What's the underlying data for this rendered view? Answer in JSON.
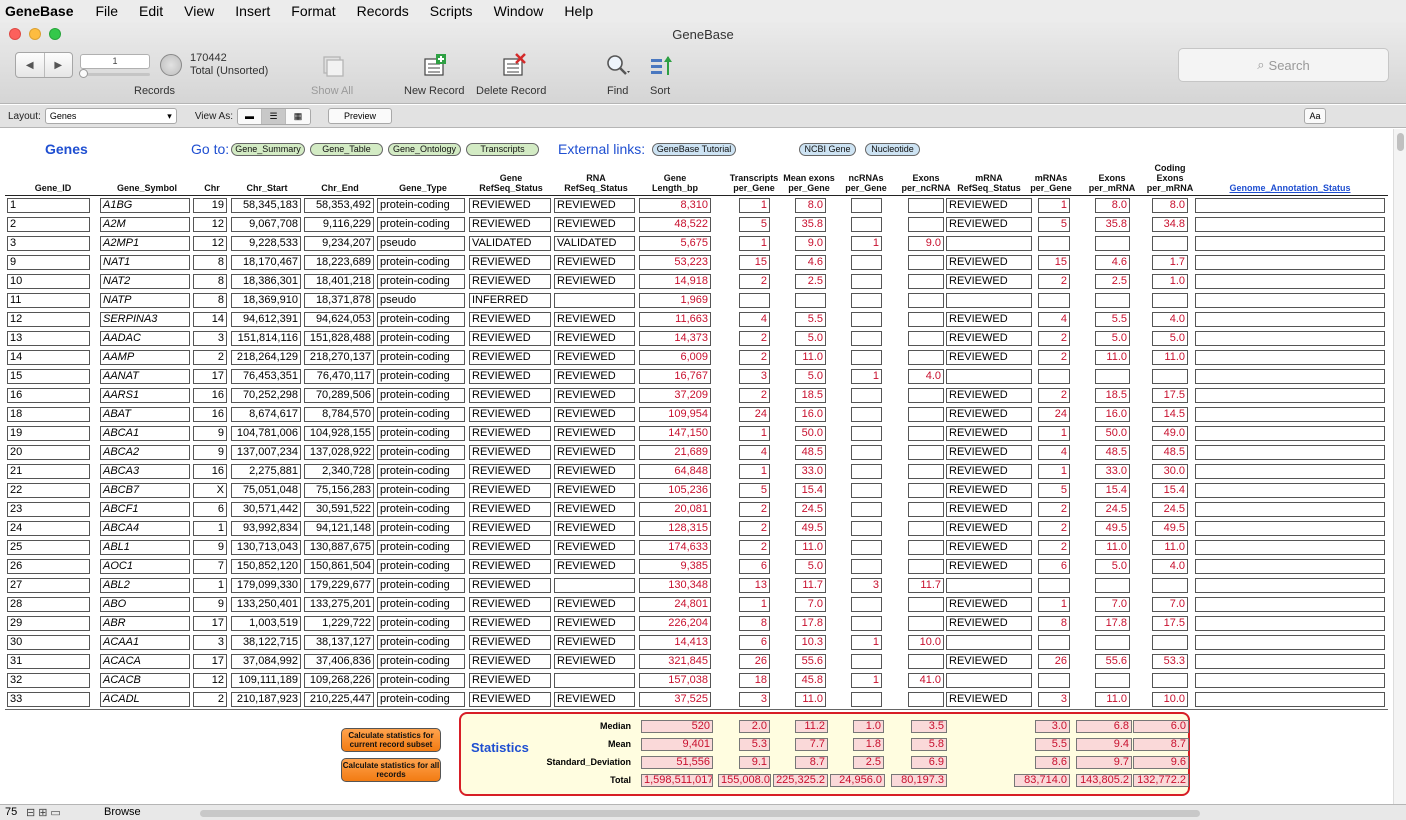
{
  "menubar": {
    "app": "GeneBase",
    "items": [
      "File",
      "Edit",
      "View",
      "Insert",
      "Format",
      "Records",
      "Scripts",
      "Window",
      "Help"
    ]
  },
  "window": {
    "title": "GeneBase"
  },
  "toolbar": {
    "record_number": "1",
    "record_count": "170442",
    "sort_state": "Total (Unsorted)",
    "records_label": "Records",
    "show_all": "Show All",
    "new_record": "New Record",
    "delete_record": "Delete Record",
    "find": "Find",
    "sort": "Sort",
    "search_placeholder": "Search"
  },
  "layoutbar": {
    "layout_label": "Layout:",
    "layout_value": "Genes",
    "view_as_label": "View As:",
    "preview": "Preview",
    "font_button": "Aa"
  },
  "header": {
    "title": "Genes",
    "goto_label": "Go to:",
    "goto_links": [
      "Gene_Summary",
      "Gene_Table",
      "Gene_Ontology",
      "Transcripts"
    ],
    "external_label": "External links:",
    "external_links": [
      "GeneBase Tutorial",
      "NCBI Gene",
      "Nucleotide"
    ]
  },
  "columns": [
    "Gene_ID",
    "Gene_Symbol",
    "Chr",
    "Chr_Start",
    "Chr_End",
    "Gene_Type",
    "Gene\nRefSeq_Status",
    "RNA\nRefSeq_Status",
    "Gene\nLength_bp",
    "Transcripts\nper_Gene",
    "Mean exons\nper_Gene",
    "ncRNAs\nper_Gene",
    "Exons\nper_ncRNA",
    "mRNA\nRefSeq_Status",
    "mRNAs\nper_Gene",
    "Exons\nper_mRNA",
    "Coding\nExons\nper_mRNA",
    "Genome_Annotation_Status"
  ],
  "rows": [
    [
      "1",
      "A1BG",
      "19",
      "58,345,183",
      "58,353,492",
      "protein-coding",
      "REVIEWED",
      "REVIEWED",
      "8,310",
      "1",
      "8.0",
      "",
      "",
      "REVIEWED",
      "1",
      "8.0",
      "8.0",
      ""
    ],
    [
      "2",
      "A2M",
      "12",
      "9,067,708",
      "9,116,229",
      "protein-coding",
      "REVIEWED",
      "REVIEWED",
      "48,522",
      "5",
      "35.8",
      "",
      "",
      "REVIEWED",
      "5",
      "35.8",
      "34.8",
      ""
    ],
    [
      "3",
      "A2MP1",
      "12",
      "9,228,533",
      "9,234,207",
      "pseudo",
      "VALIDATED",
      "VALIDATED",
      "5,675",
      "1",
      "9.0",
      "1",
      "9.0",
      "",
      "",
      "",
      "",
      ""
    ],
    [
      "9",
      "NAT1",
      "8",
      "18,170,467",
      "18,223,689",
      "protein-coding",
      "REVIEWED",
      "REVIEWED",
      "53,223",
      "15",
      "4.6",
      "",
      "",
      "REVIEWED",
      "15",
      "4.6",
      "1.7",
      ""
    ],
    [
      "10",
      "NAT2",
      "8",
      "18,386,301",
      "18,401,218",
      "protein-coding",
      "REVIEWED",
      "REVIEWED",
      "14,918",
      "2",
      "2.5",
      "",
      "",
      "REVIEWED",
      "2",
      "2.5",
      "1.0",
      ""
    ],
    [
      "11",
      "NATP",
      "8",
      "18,369,910",
      "18,371,878",
      "pseudo",
      "INFERRED",
      "",
      "1,969",
      "",
      "",
      "",
      "",
      "",
      "",
      "",
      "",
      ""
    ],
    [
      "12",
      "SERPINA3",
      "14",
      "94,612,391",
      "94,624,053",
      "protein-coding",
      "REVIEWED",
      "REVIEWED",
      "11,663",
      "4",
      "5.5",
      "",
      "",
      "REVIEWED",
      "4",
      "5.5",
      "4.0",
      ""
    ],
    [
      "13",
      "AADAC",
      "3",
      "151,814,116",
      "151,828,488",
      "protein-coding",
      "REVIEWED",
      "REVIEWED",
      "14,373",
      "2",
      "5.0",
      "",
      "",
      "REVIEWED",
      "2",
      "5.0",
      "5.0",
      ""
    ],
    [
      "14",
      "AAMP",
      "2",
      "218,264,129",
      "218,270,137",
      "protein-coding",
      "REVIEWED",
      "REVIEWED",
      "6,009",
      "2",
      "11.0",
      "",
      "",
      "REVIEWED",
      "2",
      "11.0",
      "11.0",
      ""
    ],
    [
      "15",
      "AANAT",
      "17",
      "76,453,351",
      "76,470,117",
      "protein-coding",
      "REVIEWED",
      "REVIEWED",
      "16,767",
      "3",
      "5.0",
      "1",
      "4.0",
      "",
      "",
      "",
      "",
      ""
    ],
    [
      "16",
      "AARS1",
      "16",
      "70,252,298",
      "70,289,506",
      "protein-coding",
      "REVIEWED",
      "REVIEWED",
      "37,209",
      "2",
      "18.5",
      "",
      "",
      "REVIEWED",
      "2",
      "18.5",
      "17.5",
      ""
    ],
    [
      "18",
      "ABAT",
      "16",
      "8,674,617",
      "8,784,570",
      "protein-coding",
      "REVIEWED",
      "REVIEWED",
      "109,954",
      "24",
      "16.0",
      "",
      "",
      "REVIEWED",
      "24",
      "16.0",
      "14.5",
      ""
    ],
    [
      "19",
      "ABCA1",
      "9",
      "104,781,006",
      "104,928,155",
      "protein-coding",
      "REVIEWED",
      "REVIEWED",
      "147,150",
      "1",
      "50.0",
      "",
      "",
      "REVIEWED",
      "1",
      "50.0",
      "49.0",
      ""
    ],
    [
      "20",
      "ABCA2",
      "9",
      "137,007,234",
      "137,028,922",
      "protein-coding",
      "REVIEWED",
      "REVIEWED",
      "21,689",
      "4",
      "48.5",
      "",
      "",
      "REVIEWED",
      "4",
      "48.5",
      "48.5",
      ""
    ],
    [
      "21",
      "ABCA3",
      "16",
      "2,275,881",
      "2,340,728",
      "protein-coding",
      "REVIEWED",
      "REVIEWED",
      "64,848",
      "1",
      "33.0",
      "",
      "",
      "REVIEWED",
      "1",
      "33.0",
      "30.0",
      ""
    ],
    [
      "22",
      "ABCB7",
      "X",
      "75,051,048",
      "75,156,283",
      "protein-coding",
      "REVIEWED",
      "REVIEWED",
      "105,236",
      "5",
      "15.4",
      "",
      "",
      "REVIEWED",
      "5",
      "15.4",
      "15.4",
      ""
    ],
    [
      "23",
      "ABCF1",
      "6",
      "30,571,442",
      "30,591,522",
      "protein-coding",
      "REVIEWED",
      "REVIEWED",
      "20,081",
      "2",
      "24.5",
      "",
      "",
      "REVIEWED",
      "2",
      "24.5",
      "24.5",
      ""
    ],
    [
      "24",
      "ABCA4",
      "1",
      "93,992,834",
      "94,121,148",
      "protein-coding",
      "REVIEWED",
      "REVIEWED",
      "128,315",
      "2",
      "49.5",
      "",
      "",
      "REVIEWED",
      "2",
      "49.5",
      "49.5",
      ""
    ],
    [
      "25",
      "ABL1",
      "9",
      "130,713,043",
      "130,887,675",
      "protein-coding",
      "REVIEWED",
      "REVIEWED",
      "174,633",
      "2",
      "11.0",
      "",
      "",
      "REVIEWED",
      "2",
      "11.0",
      "11.0",
      ""
    ],
    [
      "26",
      "AOC1",
      "7",
      "150,852,120",
      "150,861,504",
      "protein-coding",
      "REVIEWED",
      "REVIEWED",
      "9,385",
      "6",
      "5.0",
      "",
      "",
      "REVIEWED",
      "6",
      "5.0",
      "4.0",
      ""
    ],
    [
      "27",
      "ABL2",
      "1",
      "179,099,330",
      "179,229,677",
      "protein-coding",
      "REVIEWED",
      "",
      "130,348",
      "13",
      "11.7",
      "3",
      "11.7",
      "",
      "",
      "",
      "",
      ""
    ],
    [
      "28",
      "ABO",
      "9",
      "133,250,401",
      "133,275,201",
      "protein-coding",
      "REVIEWED",
      "REVIEWED",
      "24,801",
      "1",
      "7.0",
      "",
      "",
      "REVIEWED",
      "1",
      "7.0",
      "7.0",
      ""
    ],
    [
      "29",
      "ABR",
      "17",
      "1,003,519",
      "1,229,722",
      "protein-coding",
      "REVIEWED",
      "REVIEWED",
      "226,204",
      "8",
      "17.8",
      "",
      "",
      "REVIEWED",
      "8",
      "17.8",
      "17.5",
      ""
    ],
    [
      "30",
      "ACAA1",
      "3",
      "38,122,715",
      "38,137,127",
      "protein-coding",
      "REVIEWED",
      "REVIEWED",
      "14,413",
      "6",
      "10.3",
      "1",
      "10.0",
      "",
      "",
      "",
      "",
      ""
    ],
    [
      "31",
      "ACACA",
      "17",
      "37,084,992",
      "37,406,836",
      "protein-coding",
      "REVIEWED",
      "REVIEWED",
      "321,845",
      "26",
      "55.6",
      "",
      "",
      "REVIEWED",
      "26",
      "55.6",
      "53.3",
      ""
    ],
    [
      "32",
      "ACACB",
      "12",
      "109,111,189",
      "109,268,226",
      "protein-coding",
      "REVIEWED",
      "",
      "157,038",
      "18",
      "45.8",
      "1",
      "41.0",
      "",
      "",
      "",
      "",
      ""
    ],
    [
      "33",
      "ACADL",
      "2",
      "210,187,923",
      "210,225,447",
      "protein-coding",
      "REVIEWED",
      "REVIEWED",
      "37,525",
      "3",
      "11.0",
      "",
      "",
      "REVIEWED",
      "3",
      "11.0",
      "10.0",
      ""
    ]
  ],
  "buttons": {
    "calc_subset": "Calculate statistics for current record subset",
    "calc_all": "Calculate statistics for all records"
  },
  "statistics": {
    "title": "Statistics",
    "labels": [
      "Median",
      "Mean",
      "Standard_Deviation",
      "Total"
    ],
    "values": [
      [
        "520",
        "2.0",
        "11.2",
        "1.0",
        "3.5",
        "3.0",
        "6.8",
        "6.0"
      ],
      [
        "9,401",
        "5.3",
        "7.7",
        "1.8",
        "5.8",
        "5.5",
        "9.4",
        "8.7"
      ],
      [
        "51,556",
        "9.1",
        "8.7",
        "2.5",
        "6.9",
        "8.6",
        "9.7",
        "9.6"
      ],
      [
        "1,598,511,017",
        "155,008.0",
        "225,325.2",
        "24,956.0",
        "80,197.3",
        "83,714.0",
        "143,805.2",
        "132,772.2"
      ]
    ]
  },
  "statusbar": {
    "zoom": "75",
    "mode": "Browse"
  },
  "colors": {
    "link_blue": "#1f4fd1",
    "value_red": "#c8102e",
    "stats_border": "#d71e26",
    "button_orange": "#f27b12"
  }
}
